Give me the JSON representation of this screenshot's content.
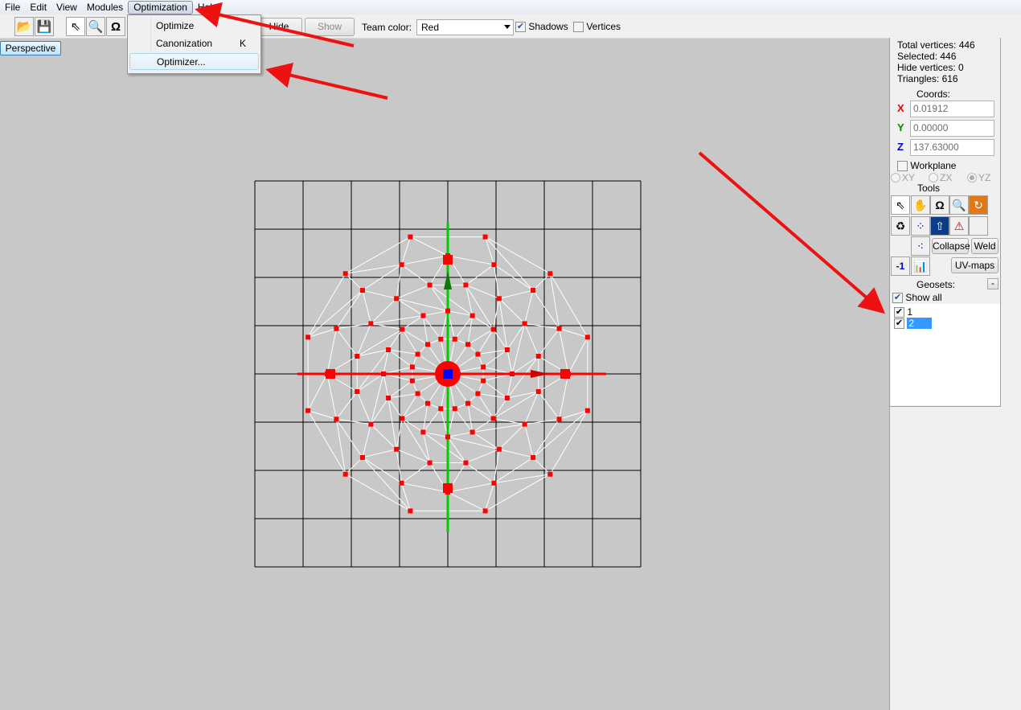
{
  "menubar": {
    "items": [
      "File",
      "Edit",
      "View",
      "Modules",
      "Optimization",
      "Help"
    ],
    "active": "Optimization"
  },
  "dropdown": {
    "items": [
      {
        "label": "Optimize",
        "shortcut": ""
      },
      {
        "label": "Canonization",
        "shortcut": "K"
      },
      {
        "label": "Optimizer...",
        "shortcut": ""
      }
    ]
  },
  "toolbar": {
    "icons": [
      "open-folder-icon",
      "save-icon",
      "select-arrow-icon",
      "zoom-icon",
      "rotate-icon"
    ],
    "hide_label": "Hide",
    "show_label": "Show",
    "team_color_label": "Team color:",
    "team_color_value": "Red",
    "shadows_label": "Shadows",
    "shadows_checked": true,
    "vertices_label": "Vertices",
    "vertices_checked": false
  },
  "viewport": {
    "mode_button": "Perspective"
  },
  "panel": {
    "total_vertices": "Total vertices: 446",
    "selected": "Selected: 446",
    "hide_vertices": "Hide vertices: 0",
    "triangles": "Triangles: 616",
    "coords_label": "Coords:",
    "x_label": "X",
    "x_value": "0.01912",
    "y_label": "Y",
    "y_value": "0.00000",
    "z_label": "Z",
    "z_value": "137.63000",
    "workplane_label": "Workplane",
    "planes": [
      "XY",
      "ZX",
      "YZ"
    ],
    "selected_plane": "YZ",
    "tools_label": "Tools",
    "collapse_label": "Collapse",
    "weld_label": "Weld",
    "minus_one_label": "-1",
    "uvmaps_label": "UV-maps",
    "geosets_label": "Geosets:",
    "geosets_collapse": "-",
    "show_all_label": "Show all",
    "geosets": [
      {
        "label": "1",
        "checked": true,
        "selected": false
      },
      {
        "label": "2",
        "checked": true,
        "selected": true
      }
    ]
  },
  "colors": {
    "axis_x": "#ff0000",
    "axis_y": "#00cc00",
    "axis_z": "#0000ff",
    "vertex": "#ff0000",
    "wire": "#ffffff",
    "annotation_arrow": "#ee1111",
    "viewport_bg": "#c8c8c8"
  }
}
